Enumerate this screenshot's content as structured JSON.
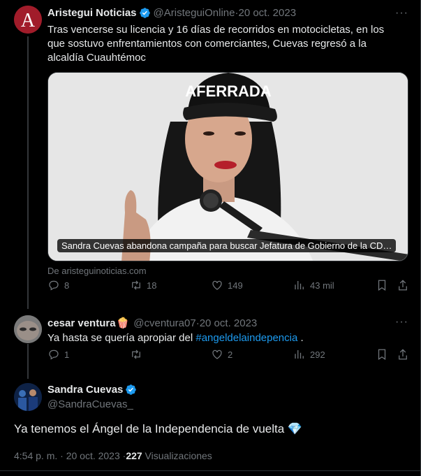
{
  "tweet1": {
    "author_name": "Aristegui Noticias",
    "handle": "@AristeguiOnline",
    "date": "20 oct. 2023",
    "text": "Tras vencerse su licencia y  16 días de recorridos en motocicletas, en los que sostuvo enfrentamientos con comerciantes, Cuevas regresó a la alcaldía Cuauhtémoc",
    "card_caption": "Sandra Cuevas abandona campaña para buscar Jefatura de Gobierno de la CD…",
    "card_source": "De aristeguinoticias.com",
    "cap_text": "AFERRADA",
    "avatar_letter": "A",
    "stats": {
      "replies": "8",
      "retweets": "18",
      "likes": "149",
      "views": "43 mil"
    }
  },
  "tweet2": {
    "author_name": "cesar ventura",
    "name_emoji": "🍿",
    "handle": "@cventura07",
    "date": "20 oct. 2023",
    "text_before": "Ya hasta se quería apropiar del ",
    "hashtag": "#angeldelaindepencia",
    "text_after": " .",
    "stats": {
      "replies": "1",
      "retweets": "",
      "likes": "2",
      "views": "292"
    }
  },
  "tweet3": {
    "author_name": "Sandra Cuevas",
    "handle": "@SandraCuevas_",
    "text": "Ya tenemos el Ángel de la Independencia de vuelta 💎",
    "time": "4:54 p. m. · 20 oct. 2023 · ",
    "views_count": "227",
    "views_label": " Visualizaciones"
  },
  "common": {
    "separator": " · ",
    "more": "···"
  },
  "colors": {
    "accent": "#1d9bf0",
    "muted": "#71767b",
    "background": "#000000"
  }
}
